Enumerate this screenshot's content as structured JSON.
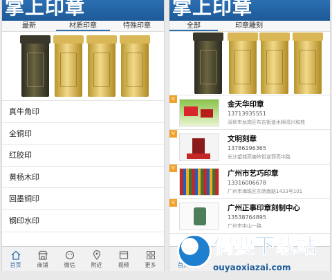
{
  "app_title": "掌上印章",
  "left": {
    "tabs": [
      "最新",
      "材质印章",
      "特殊印章"
    ],
    "active_tab": 1,
    "materials": [
      "真牛角印",
      "全铜印",
      "红胶印",
      "黄杨木印",
      "回墨铜印",
      "钢印水印"
    ],
    "nav": [
      {
        "label": "首页",
        "icon": "home-icon"
      },
      {
        "label": "商铺",
        "icon": "shop-icon"
      },
      {
        "label": "微信",
        "icon": "wechat-icon"
      },
      {
        "label": "附近",
        "icon": "location-pin-icon"
      },
      {
        "label": "视频",
        "icon": "video-icon"
      },
      {
        "label": "更多",
        "icon": "grid-icon"
      }
    ]
  },
  "right": {
    "tabs": [
      "全部",
      "印章雕刻"
    ],
    "active_tab": 0,
    "shops": [
      {
        "flag": "V",
        "name": "金天华印章",
        "phone": "13713935551",
        "address": "深圳市龙岗区布吉街道木棉湾兴和苑"
      },
      {
        "flag": "V",
        "name": "文明刻章",
        "phone": "13786196365",
        "address": "长沙望城高塘岭街道郭亮中路"
      },
      {
        "flag": "V",
        "name": "广州市艺巧印章",
        "phone": "13316006678",
        "address": "广州市海珠区东晓南路1433号101"
      },
      {
        "flag": "V",
        "name": "广州正事印章刻制中心",
        "phone": "13538764895",
        "address": "广州市中山一路"
      }
    ],
    "nav": [
      {
        "label": "首页",
        "icon": "home-icon"
      }
    ]
  },
  "watermark": {
    "title": "偶要下载站",
    "domain": "ouyaoxiazai.com"
  }
}
